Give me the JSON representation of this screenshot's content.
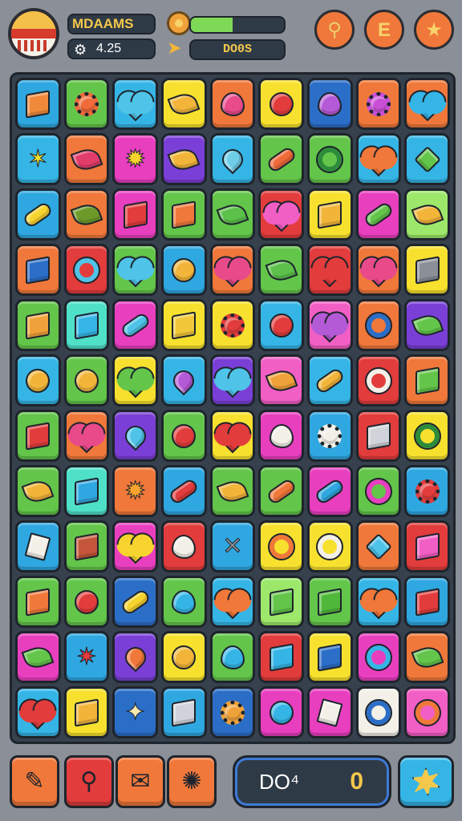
{
  "header": {
    "player_name": "MDAAMS",
    "score_value": "4.25",
    "coins_value": "DO0S",
    "energy_level": 0.45,
    "buttons": [
      {
        "name": "pin-button",
        "icon": "pin-icon",
        "glyph": "⚲"
      },
      {
        "name": "e-button",
        "icon": "e-letter-icon",
        "glyph": "E"
      },
      {
        "name": "star-button",
        "icon": "star-icon",
        "glyph": "★"
      }
    ]
  },
  "board": {
    "columns": 9,
    "rows": 12,
    "tiles": [
      {
        "bg": "#2fa7e0",
        "icon": "crate",
        "shape": "cube",
        "fg": "#f08a3a"
      },
      {
        "bg": "#63c54a",
        "icon": "gear",
        "shape": "gear",
        "fg": "#f06a3a"
      },
      {
        "bg": "#35b5e6",
        "icon": "heart",
        "shape": "heart",
        "fg": "#4fc3e8"
      },
      {
        "bg": "#f7e12e",
        "icon": "lemon",
        "shape": "leaf",
        "fg": "#f2b53a"
      },
      {
        "bg": "#f0783a",
        "icon": "strawberry",
        "shape": "blob",
        "fg": "#e84a8a"
      },
      {
        "bg": "#f7e12e",
        "icon": "balloon",
        "shape": "circle",
        "fg": "#e23c3c"
      },
      {
        "bg": "#2b6ec7",
        "icon": "grapes",
        "shape": "blob",
        "fg": "#b55ad6"
      },
      {
        "bg": "#f0783a",
        "icon": "gear",
        "shape": "gear",
        "fg": "#c94fd6"
      },
      {
        "bg": "#f0783a",
        "icon": "heart",
        "shape": "heart",
        "fg": "#35b5e6"
      },
      {
        "bg": "#35b5e6",
        "icon": "figure",
        "shape": "star",
        "fg": "#f7e12e",
        "glyph": "✶"
      },
      {
        "bg": "#f0783a",
        "icon": "chili",
        "shape": "leaf",
        "fg": "#e23c6a"
      },
      {
        "bg": "#e83fbf",
        "icon": "sun",
        "shape": "star",
        "fg": "#f7d32e",
        "glyph": "✹"
      },
      {
        "bg": "#7a3fd6",
        "icon": "carrot",
        "shape": "leaf",
        "fg": "#f2b53a"
      },
      {
        "bg": "#35b5e6",
        "icon": "drop",
        "shape": "drop",
        "fg": "#6fcde8"
      },
      {
        "bg": "#63c54a",
        "icon": "carrot",
        "shape": "pill",
        "fg": "#f06a3a"
      },
      {
        "bg": "#63c54a",
        "icon": "wheel",
        "shape": "ring",
        "fg": "#2d8c3a"
      },
      {
        "bg": "#35b5e6",
        "icon": "heart",
        "shape": "heart",
        "fg": "#f0783a"
      },
      {
        "bg": "#35b5e6",
        "icon": "cone",
        "shape": "diamond",
        "fg": "#63c54a"
      },
      {
        "bg": "#2fa7e0",
        "icon": "rocket",
        "shape": "pill",
        "fg": "#f7d32e"
      },
      {
        "bg": "#f0783a",
        "icon": "leaf",
        "shape": "leaf",
        "fg": "#6b9a2a"
      },
      {
        "bg": "#e83fbf",
        "icon": "book-stack",
        "shape": "cube",
        "fg": "#e23c3c"
      },
      {
        "bg": "#63c54a",
        "icon": "jar",
        "shape": "cube",
        "fg": "#f0783a"
      },
      {
        "bg": "#63c54a",
        "icon": "leaf",
        "shape": "leaf",
        "fg": "#5cc04a"
      },
      {
        "bg": "#e23c3c",
        "icon": "heart",
        "shape": "heart",
        "fg": "#f25fc4"
      },
      {
        "bg": "#f7e12e",
        "icon": "crate",
        "shape": "cube",
        "fg": "#f2b53a"
      },
      {
        "bg": "#e83fbf",
        "icon": "pickle",
        "shape": "pill",
        "fg": "#63c54a"
      },
      {
        "bg": "#9de86a",
        "icon": "lemon",
        "shape": "leaf",
        "fg": "#f2b53a"
      },
      {
        "bg": "#f0783a",
        "icon": "book-stack",
        "shape": "cube",
        "fg": "#2b6ec7"
      },
      {
        "bg": "#e23c3c",
        "icon": "magnifier",
        "shape": "ring",
        "fg": "#4fc3e8"
      },
      {
        "bg": "#63c54a",
        "icon": "heart",
        "shape": "heart",
        "fg": "#4fc3e8"
      },
      {
        "bg": "#2fa7e0",
        "icon": "lollipop",
        "shape": "circle",
        "fg": "#f2b53a"
      },
      {
        "bg": "#f0783a",
        "icon": "heart",
        "shape": "heart",
        "fg": "#e84a8a"
      },
      {
        "bg": "#63c54a",
        "icon": "leaf",
        "shape": "leaf",
        "fg": "#5cc04a"
      },
      {
        "bg": "#e23c3c",
        "icon": "heart",
        "shape": "heart",
        "fg": "#e23c3c"
      },
      {
        "bg": "#f0783a",
        "icon": "heart",
        "shape": "heart",
        "fg": "#e84a8a"
      },
      {
        "bg": "#f7e12e",
        "icon": "cheese",
        "shape": "cube",
        "fg": "#8a8f98"
      },
      {
        "bg": "#63c54a",
        "icon": "crate",
        "shape": "cube",
        "fg": "#f0a23a"
      },
      {
        "bg": "#4fe0c8",
        "icon": "cube",
        "shape": "cube",
        "fg": "#35b5e6"
      },
      {
        "bg": "#e83fbf",
        "icon": "pencil",
        "shape": "pill",
        "fg": "#4fc3e8"
      },
      {
        "bg": "#f7e12e",
        "icon": "book-stack",
        "shape": "cube",
        "fg": "#f2c83a"
      },
      {
        "bg": "#f7e12e",
        "icon": "flower",
        "shape": "gear",
        "fg": "#e23c3c"
      },
      {
        "bg": "#35b5e6",
        "icon": "button",
        "shape": "circle",
        "fg": "#e23c3c"
      },
      {
        "bg": "#f25fc4",
        "icon": "heart",
        "shape": "heart",
        "fg": "#b55ad6"
      },
      {
        "bg": "#f0783a",
        "icon": "ring",
        "shape": "ring",
        "fg": "#2b6ec7"
      },
      {
        "bg": "#7a3fd6",
        "icon": "flower",
        "shape": "leaf",
        "fg": "#63c54a"
      },
      {
        "bg": "#35b5e6",
        "icon": "lemon",
        "shape": "circle",
        "fg": "#f2b53a"
      },
      {
        "bg": "#63c54a",
        "icon": "lollipop",
        "shape": "circle",
        "fg": "#f2b53a"
      },
      {
        "bg": "#f7e12e",
        "icon": "heart",
        "shape": "heart",
        "fg": "#63c54a"
      },
      {
        "bg": "#35b5e6",
        "icon": "eggplant",
        "shape": "drop",
        "fg": "#b55ad6"
      },
      {
        "bg": "#7a3fd6",
        "icon": "heart",
        "shape": "heart",
        "fg": "#4fc3e8"
      },
      {
        "bg": "#f25fc4",
        "icon": "melon",
        "shape": "leaf",
        "fg": "#f0a23a"
      },
      {
        "bg": "#35b5e6",
        "icon": "cone",
        "shape": "pill",
        "fg": "#f2b53a"
      },
      {
        "bg": "#e23c3c",
        "icon": "magnifier",
        "shape": "ring",
        "fg": "#f3f0e8"
      },
      {
        "bg": "#f0783a",
        "icon": "cake",
        "shape": "cube",
        "fg": "#63c54a"
      },
      {
        "bg": "#63c54a",
        "icon": "book-stack",
        "shape": "cube",
        "fg": "#e23c3c"
      },
      {
        "bg": "#f0783a",
        "icon": "apple",
        "shape": "heart",
        "fg": "#e84a8a"
      },
      {
        "bg": "#7a3fd6",
        "icon": "fish",
        "shape": "drop",
        "fg": "#4fc3e8"
      },
      {
        "bg": "#63c54a",
        "icon": "apple",
        "shape": "circle",
        "fg": "#e23c3c"
      },
      {
        "bg": "#f7e12e",
        "icon": "heart",
        "shape": "heart",
        "fg": "#e23c3c"
      },
      {
        "bg": "#e83fbf",
        "icon": "cauliflower",
        "shape": "blob",
        "fg": "#f3f0e8"
      },
      {
        "bg": "#2fa7e0",
        "icon": "gear",
        "shape": "gear",
        "fg": "#f3f0e8"
      },
      {
        "bg": "#e23c3c",
        "icon": "safe",
        "shape": "cube",
        "fg": "#d0d4da"
      },
      {
        "bg": "#f7e12e",
        "icon": "target",
        "shape": "ring",
        "fg": "#2d8c3a"
      },
      {
        "bg": "#63c54a",
        "icon": "lemon",
        "shape": "leaf",
        "fg": "#f2b53a"
      },
      {
        "bg": "#4fe0c8",
        "icon": "envelope",
        "shape": "cube",
        "fg": "#2fa7e0"
      },
      {
        "bg": "#f0783a",
        "icon": "sun",
        "shape": "star",
        "fg": "#f7a32e",
        "glyph": "✹"
      },
      {
        "bg": "#2fa7e0",
        "icon": "carrot",
        "shape": "pill",
        "fg": "#e23c3c"
      },
      {
        "bg": "#63c54a",
        "icon": "lemon",
        "shape": "leaf",
        "fg": "#f2b53a"
      },
      {
        "bg": "#63c54a",
        "icon": "mace",
        "shape": "pill",
        "fg": "#f0783a"
      },
      {
        "bg": "#e83fbf",
        "icon": "capsule",
        "shape": "pill",
        "fg": "#2fa7e0"
      },
      {
        "bg": "#63c54a",
        "icon": "lasso",
        "shape": "ring",
        "fg": "#e83fbf"
      },
      {
        "bg": "#2fa7e0",
        "icon": "flower",
        "shape": "gear",
        "fg": "#e23c3c"
      },
      {
        "bg": "#2fa7e0",
        "icon": "paper",
        "shape": "note",
        "fg": "#f3f0e8"
      },
      {
        "bg": "#63c54a",
        "icon": "book-stack",
        "shape": "cube",
        "fg": "#c4553a"
      },
      {
        "bg": "#e83fbf",
        "icon": "heart",
        "shape": "heart",
        "fg": "#f7d32e"
      },
      {
        "bg": "#e23c3c",
        "icon": "marshmallow",
        "shape": "blob",
        "fg": "#f3f0e8"
      },
      {
        "bg": "#2fa7e0",
        "icon": "cross-tools",
        "shape": "star",
        "fg": "#8a8f98",
        "glyph": "✕"
      },
      {
        "bg": "#f7e12e",
        "icon": "ring",
        "shape": "ring",
        "fg": "#f0783a"
      },
      {
        "bg": "#f7e12e",
        "icon": "magnifier",
        "shape": "ring",
        "fg": "#f3f0e8"
      },
      {
        "bg": "#f0783a",
        "icon": "gem",
        "shape": "diamond",
        "fg": "#4fc3e8"
      },
      {
        "bg": "#e23c3c",
        "icon": "robot",
        "shape": "cube",
        "fg": "#f25fc4"
      },
      {
        "bg": "#63c54a",
        "icon": "book-stack",
        "shape": "cube",
        "fg": "#f0783a"
      },
      {
        "bg": "#63c54a",
        "icon": "mace",
        "shape": "circle",
        "fg": "#e23c3c"
      },
      {
        "bg": "#2b6ec7",
        "icon": "pencil",
        "shape": "pill",
        "fg": "#f7d32e"
      },
      {
        "bg": "#63c54a",
        "icon": "berries",
        "shape": "blob",
        "fg": "#35b5e6"
      },
      {
        "bg": "#35b5e6",
        "icon": "heart",
        "shape": "heart",
        "fg": "#f0783a"
      },
      {
        "bg": "#9de86a",
        "icon": "cube",
        "shape": "cube",
        "fg": "#63c54a"
      },
      {
        "bg": "#63c54a",
        "icon": "cube",
        "shape": "cube",
        "fg": "#4fb83a"
      },
      {
        "bg": "#35b5e6",
        "icon": "heart",
        "shape": "heart",
        "fg": "#f0783a"
      },
      {
        "bg": "#2fa7e0",
        "icon": "cake",
        "shape": "cube",
        "fg": "#e23c3c"
      },
      {
        "bg": "#e83fbf",
        "icon": "leaf",
        "shape": "leaf",
        "fg": "#63c54a"
      },
      {
        "bg": "#2fa7e0",
        "icon": "crab",
        "shape": "star",
        "fg": "#e23c3c",
        "glyph": "✷"
      },
      {
        "bg": "#7a3fd6",
        "icon": "carrot",
        "shape": "drop",
        "fg": "#f0783a"
      },
      {
        "bg": "#f7e12e",
        "icon": "lemon",
        "shape": "circle",
        "fg": "#f2b53a"
      },
      {
        "bg": "#63c54a",
        "icon": "turtle",
        "shape": "blob",
        "fg": "#35b5e6"
      },
      {
        "bg": "#e23c3c",
        "icon": "cube",
        "shape": "cube",
        "fg": "#35b5e6"
      },
      {
        "bg": "#f7e12e",
        "icon": "table",
        "shape": "cube",
        "fg": "#2b6ec7"
      },
      {
        "bg": "#e83fbf",
        "icon": "target",
        "shape": "ring",
        "fg": "#35b5e6"
      },
      {
        "bg": "#f0783a",
        "icon": "leaf",
        "shape": "leaf",
        "fg": "#63c54a"
      },
      {
        "bg": "#35b5e6",
        "icon": "heart",
        "shape": "heart",
        "fg": "#e23c3c"
      },
      {
        "bg": "#f7e12e",
        "icon": "crate",
        "shape": "cube",
        "fg": "#f2b53a"
      },
      {
        "bg": "#2b6ec7",
        "icon": "starfish",
        "shape": "star",
        "fg": "#f7e8b0",
        "glyph": "✦"
      },
      {
        "bg": "#2fa7e0",
        "icon": "phone",
        "shape": "cube",
        "fg": "#d0d4da"
      },
      {
        "bg": "#2b6ec7",
        "icon": "cookie",
        "shape": "gear",
        "fg": "#f0a23a"
      },
      {
        "bg": "#e83fbf",
        "icon": "balloon",
        "shape": "circle",
        "fg": "#35b5e6"
      },
      {
        "bg": "#e83fbf",
        "icon": "eraser",
        "shape": "note",
        "fg": "#f3f0e8"
      },
      {
        "bg": "#f3f0e8",
        "icon": "target",
        "shape": "ring",
        "fg": "#2b6ec7"
      },
      {
        "bg": "#f25fc4",
        "icon": "ring",
        "shape": "ring",
        "fg": "#f0783a"
      }
    ]
  },
  "footer": {
    "tools": [
      {
        "name": "pencil-tool",
        "icon": "pencil-icon",
        "glyph": "✎"
      },
      {
        "name": "search-tool",
        "icon": "magnifier-icon",
        "glyph": "⚲"
      },
      {
        "name": "mail-tool",
        "icon": "envelope-icon",
        "glyph": "✉"
      },
      {
        "name": "cookie-tool",
        "icon": "cookie-icon",
        "glyph": "✺"
      }
    ],
    "counter_label": "DO⁴",
    "counter_value": "0",
    "power_icon": "burst-icon"
  }
}
